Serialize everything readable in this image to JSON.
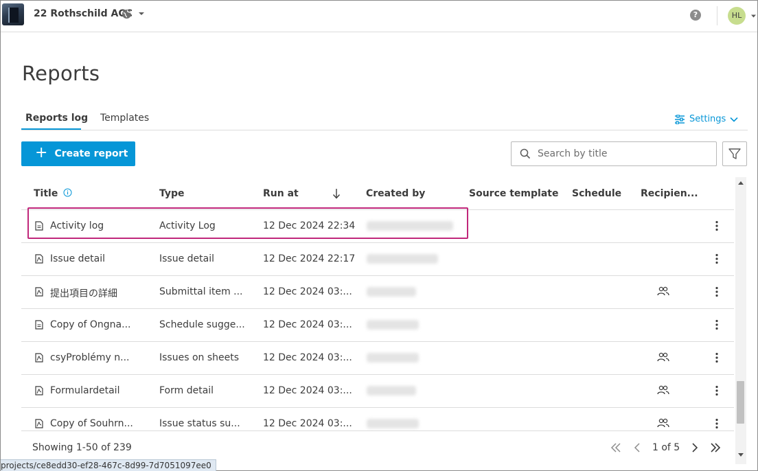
{
  "header": {
    "project_name": "22 Rothschild ACC",
    "avatar_initials": "HL"
  },
  "page": {
    "title": "Reports"
  },
  "tabs": [
    {
      "label": "Reports log",
      "active": true
    },
    {
      "label": "Templates",
      "active": false
    }
  ],
  "settings_label": "Settings",
  "toolbar": {
    "create_label": "Create report",
    "search_placeholder": "Search by title"
  },
  "table": {
    "columns": {
      "title": "Title",
      "type": "Type",
      "run_at": "Run at",
      "created_by": "Created by",
      "source_template": "Source template",
      "schedule": "Schedule",
      "recipients": "Recipien..."
    },
    "rows": [
      {
        "title": "Activity log",
        "type": "Activity Log",
        "run_at": "12 Dec 2024 22:34",
        "icon": "document-icon",
        "has_recipients": false
      },
      {
        "title": "Issue detail",
        "type": "Issue detail",
        "run_at": "12 Dec 2024 22:17",
        "icon": "pdf-icon",
        "has_recipients": false
      },
      {
        "title": "提出項目の詳細",
        "type": "Submittal item ...",
        "run_at": "12 Dec 2024 03:...",
        "icon": "pdf-icon",
        "has_recipients": true
      },
      {
        "title": "Copy of Ongna...",
        "type": "Schedule sugge...",
        "run_at": "12 Dec 2024 03:...",
        "icon": "document-icon",
        "has_recipients": false
      },
      {
        "title": "csyProblémy n...",
        "type": "Issues on sheets",
        "run_at": "12 Dec 2024 03:...",
        "icon": "pdf-icon",
        "has_recipients": true
      },
      {
        "title": "Formulardetail",
        "type": "Form detail",
        "run_at": "12 Dec 2024 03:...",
        "icon": "pdf-icon",
        "has_recipients": true
      },
      {
        "title": "Copy of Souhrn...",
        "type": "Issue status su...",
        "run_at": "12 Dec 2024 03:...",
        "icon": "pdf-icon",
        "has_recipients": true
      }
    ]
  },
  "footer": {
    "showing": "Showing 1-50 of 239",
    "page_info": "1 of 5"
  },
  "status_url": "projects/ce8edd30-ef28-467c-8d99-7d7051097ee0",
  "colors": {
    "accent": "#0696d7",
    "highlight": "#c0267a"
  }
}
